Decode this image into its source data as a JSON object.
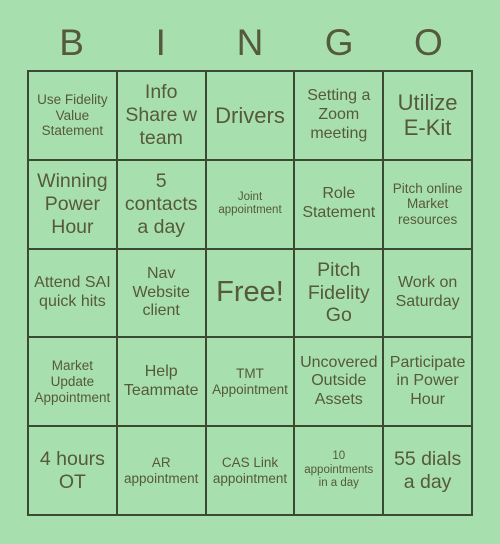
{
  "card": {
    "title": "BINGO",
    "header_letters": [
      "B",
      "I",
      "N",
      "G",
      "O"
    ],
    "colors": {
      "background": "#a8dfae",
      "cell_background": "#a8dfae",
      "text": "#55593d",
      "border": "#3d4a33"
    },
    "columns": 5,
    "rows": 5,
    "cells": [
      {
        "text": "Use Fidelity Value Statement",
        "size": "sm",
        "free": false
      },
      {
        "text": "Info Share w team",
        "size": "lg",
        "free": false
      },
      {
        "text": "Drivers",
        "size": "xl",
        "free": false
      },
      {
        "text": "Setting a Zoom meeting",
        "size": "md",
        "free": false
      },
      {
        "text": "Utilize E-Kit",
        "size": "xl",
        "free": false
      },
      {
        "text": "Winning Power Hour",
        "size": "lg",
        "free": false
      },
      {
        "text": "5 contacts a day",
        "size": "lg",
        "free": false
      },
      {
        "text": "Joint appointment",
        "size": "xs",
        "free": false
      },
      {
        "text": "Role Statement",
        "size": "md",
        "free": false
      },
      {
        "text": "Pitch online Market resources",
        "size": "sm",
        "free": false
      },
      {
        "text": "Attend SAI quick hits",
        "size": "md",
        "free": false
      },
      {
        "text": "Nav Website client",
        "size": "md",
        "free": false
      },
      {
        "text": "Free!",
        "size": "free",
        "free": true
      },
      {
        "text": "Pitch Fidelity Go",
        "size": "lg",
        "free": false
      },
      {
        "text": "Work on Saturday",
        "size": "md",
        "free": false
      },
      {
        "text": "Market Update Appointment",
        "size": "sm",
        "free": false
      },
      {
        "text": "Help Teammate",
        "size": "md",
        "free": false
      },
      {
        "text": "TMT Appointment",
        "size": "sm",
        "free": false
      },
      {
        "text": "Uncovered Outside Assets",
        "size": "md",
        "free": false
      },
      {
        "text": "Participate in Power Hour",
        "size": "md",
        "free": false
      },
      {
        "text": "4 hours OT",
        "size": "lg",
        "free": false
      },
      {
        "text": "AR appointment",
        "size": "sm",
        "free": false
      },
      {
        "text": "CAS Link appointment",
        "size": "sm",
        "free": false
      },
      {
        "text": "10 appointments in a day",
        "size": "xs",
        "free": false
      },
      {
        "text": "55 dials a day",
        "size": "lg",
        "free": false
      }
    ]
  }
}
